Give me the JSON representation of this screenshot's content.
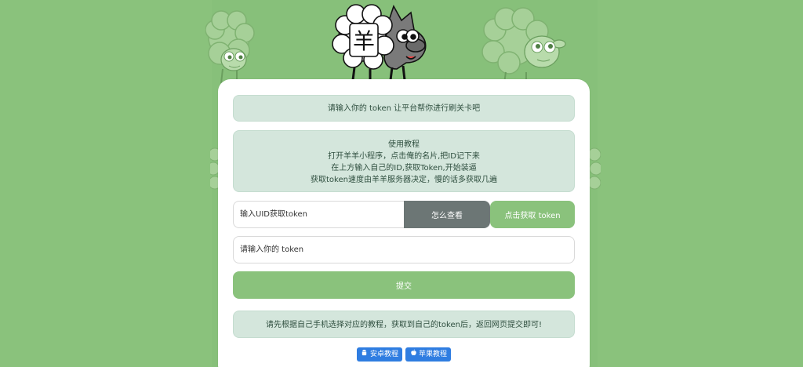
{
  "top_notice": "请输入你的 token 让平台帮你进行刷关卡吧",
  "tutorial": {
    "title": "使用教程",
    "lines": [
      "打开羊羊小程序，点击俺的名片,把ID记下来",
      "在上方输入自己的ID,获取Token,开始装逼",
      "获取token速度由羊羊服务器决定，慢的话多获取几遍"
    ]
  },
  "uid_input": {
    "placeholder": "输入UID获取token",
    "value": ""
  },
  "howto_label": "怎么查看",
  "get_token_label": "点击获取 token",
  "token_input": {
    "placeholder": "请输入你的 token",
    "value": ""
  },
  "submit_label": "提交",
  "bottom_notice": "请先根据自己手机选择对应的教程，获取到自己的token后，返回网页提交即可!",
  "tutorial_buttons": {
    "android": {
      "label": "安卓教程",
      "icon": "android-icon"
    },
    "apple": {
      "label": "苹果教程",
      "icon": "apple-icon"
    }
  },
  "logo_char": "羊",
  "colors": {
    "background": "#8ac27c",
    "accent": "#8ac27c",
    "info_box": "#d4e6dc",
    "howto_button": "#6c7675",
    "tutorial_button": "#2f7de1"
  }
}
